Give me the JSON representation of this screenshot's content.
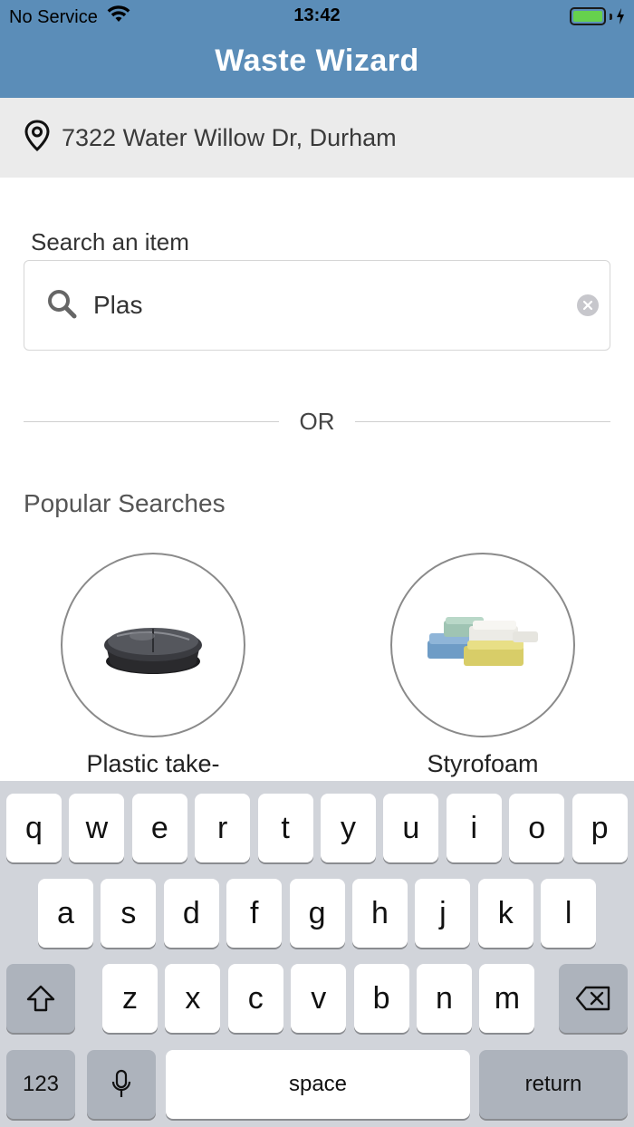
{
  "status_bar": {
    "carrier": "No Service",
    "time": "13:42"
  },
  "header": {
    "title": "Waste Wizard"
  },
  "address": {
    "text": "7322 Water Willow Dr, Durham",
    "icon": "location-pin-icon"
  },
  "search": {
    "label": "Search an item",
    "value": "Plas",
    "icon": "search-icon",
    "clear_icon": "clear-icon"
  },
  "divider": {
    "text": "OR"
  },
  "popular": {
    "title": "Popular Searches",
    "items": [
      {
        "label": "Plastic take-",
        "image": "takeout-container-image"
      },
      {
        "label": "Styrofoam",
        "image": "egg-cartons-image"
      }
    ]
  },
  "keyboard": {
    "row1": [
      "q",
      "w",
      "e",
      "r",
      "t",
      "y",
      "u",
      "i",
      "o",
      "p"
    ],
    "row2": [
      "a",
      "s",
      "d",
      "f",
      "g",
      "h",
      "j",
      "k",
      "l"
    ],
    "row3": [
      "z",
      "x",
      "c",
      "v",
      "b",
      "n",
      "m"
    ],
    "numbers_key": "123",
    "space_key": "space",
    "return_key": "return"
  },
  "colors": {
    "header": "#5b8db8",
    "address_bg": "#ebebeb",
    "keyboard_bg": "#d1d4da",
    "battery": "#66d14d"
  }
}
